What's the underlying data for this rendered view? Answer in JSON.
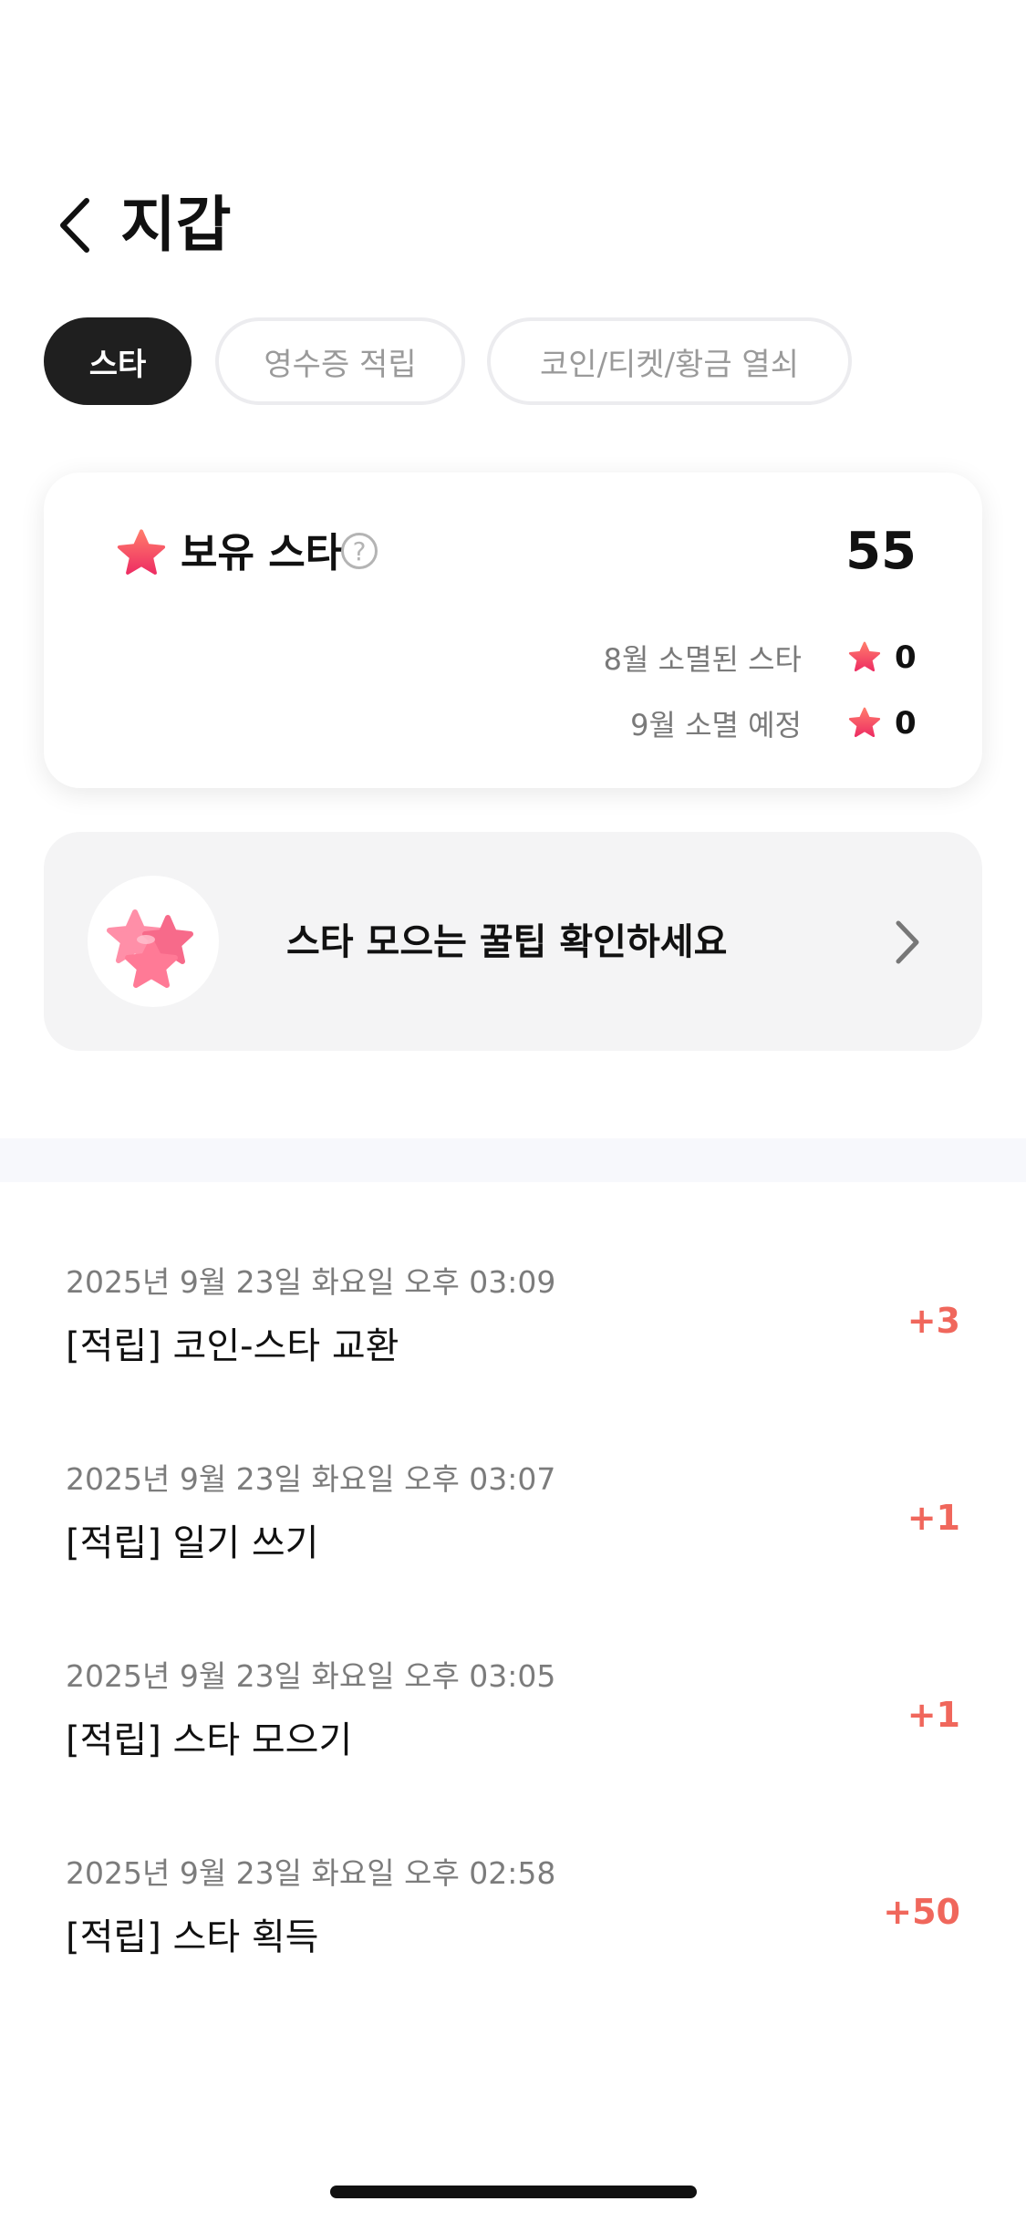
{
  "header": {
    "title": "지갑"
  },
  "tabs": [
    {
      "label": "스타",
      "active": true
    },
    {
      "label": "영수증 적립",
      "active": false
    },
    {
      "label": "코인/티켓/황금 열쇠",
      "active": false
    }
  ],
  "balance": {
    "label": "보유 스타",
    "value": "55",
    "expirations": [
      {
        "label": "8월 소멸된 스타",
        "value": "0"
      },
      {
        "label": "9월 소멸 예정",
        "value": "0"
      }
    ]
  },
  "tip": {
    "text": "스타 모으는 꿀팁 확인하세요"
  },
  "history": [
    {
      "date": "2025년 9월 23일 화요일 오후 03:09",
      "title": "[적립] 코인-스타 교환",
      "amount": "+3"
    },
    {
      "date": "2025년 9월 23일 화요일 오후 03:07",
      "title": "[적립] 일기 쓰기",
      "amount": "+1"
    },
    {
      "date": "2025년 9월 23일 화요일 오후 03:05",
      "title": "[적립] 스타 모으기",
      "amount": "+1"
    },
    {
      "date": "2025년 9월 23일 화요일 오후 02:58",
      "title": "[적립] 스타 획득",
      "amount": "+50"
    }
  ],
  "icons": {
    "back": "chevron-left-icon",
    "star": "star-icon",
    "help": "question-circle-icon",
    "tip_chevron": "chevron-right-icon",
    "tip_image": "pink-stars-illustration"
  },
  "colors": {
    "accent": "#f0675c",
    "active_tab": "#1f1f1f",
    "star": "#f2455e",
    "banner_bg": "#f4f4f5"
  }
}
